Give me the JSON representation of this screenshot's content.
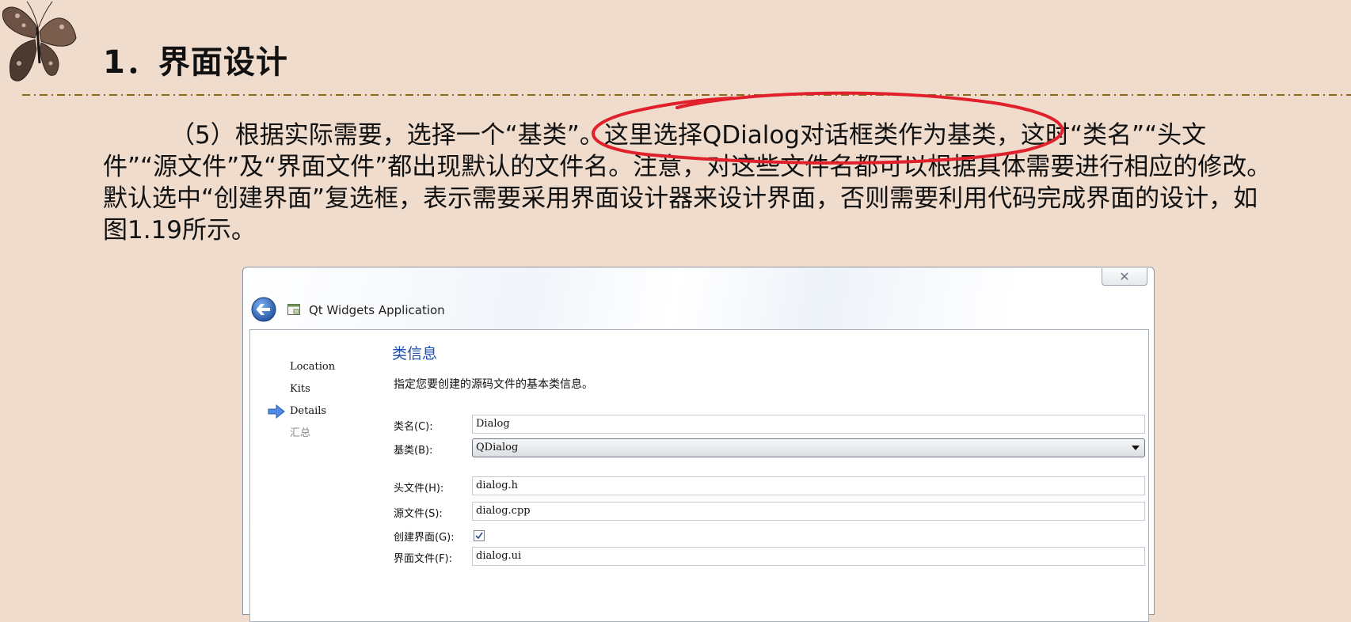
{
  "slide": {
    "title": "1．界面设计",
    "paragraph": "（5）根据实际需要，选择一个“基类”。这里选择QDialog对话框类作为基类，这时“类名”“头文件”“源文件”及“界面文件”都出现默认的文件名。注意，对这些文件名都可以根据具体需要进行相应的修改。默认选中“创建界面”复选框，表示需要采用界面设计器来设计界面，否则需要利用代码完成界面的设计，如图1.19所示。"
  },
  "colors": {
    "background": "#efdccd",
    "divider": "#8a6a1a",
    "annotation": "#e0202a",
    "section_title": "#1f4fb0"
  },
  "dialog": {
    "title": "Qt Widgets Application",
    "close_glyph": "✕",
    "steps": [
      {
        "label": "Location",
        "active": false,
        "enabled": true
      },
      {
        "label": "Kits",
        "active": false,
        "enabled": true
      },
      {
        "label": "Details",
        "active": true,
        "enabled": true
      },
      {
        "label": "汇总",
        "active": false,
        "enabled": false
      }
    ],
    "section_title": "类信息",
    "section_desc": "指定您要创建的源码文件的基本类信息。",
    "fields": {
      "class_name": {
        "label": "类名(C):",
        "value": "Dialog"
      },
      "base_class": {
        "label": "基类(B):",
        "value": "QDialog"
      },
      "header_file": {
        "label": "头文件(H):",
        "value": "dialog.h"
      },
      "source_file": {
        "label": "源文件(S):",
        "value": "dialog.cpp"
      },
      "generate_form": {
        "label": "创建界面(G):",
        "checked": true
      },
      "form_file": {
        "label": "界面文件(F):",
        "value": "dialog.ui"
      }
    }
  }
}
